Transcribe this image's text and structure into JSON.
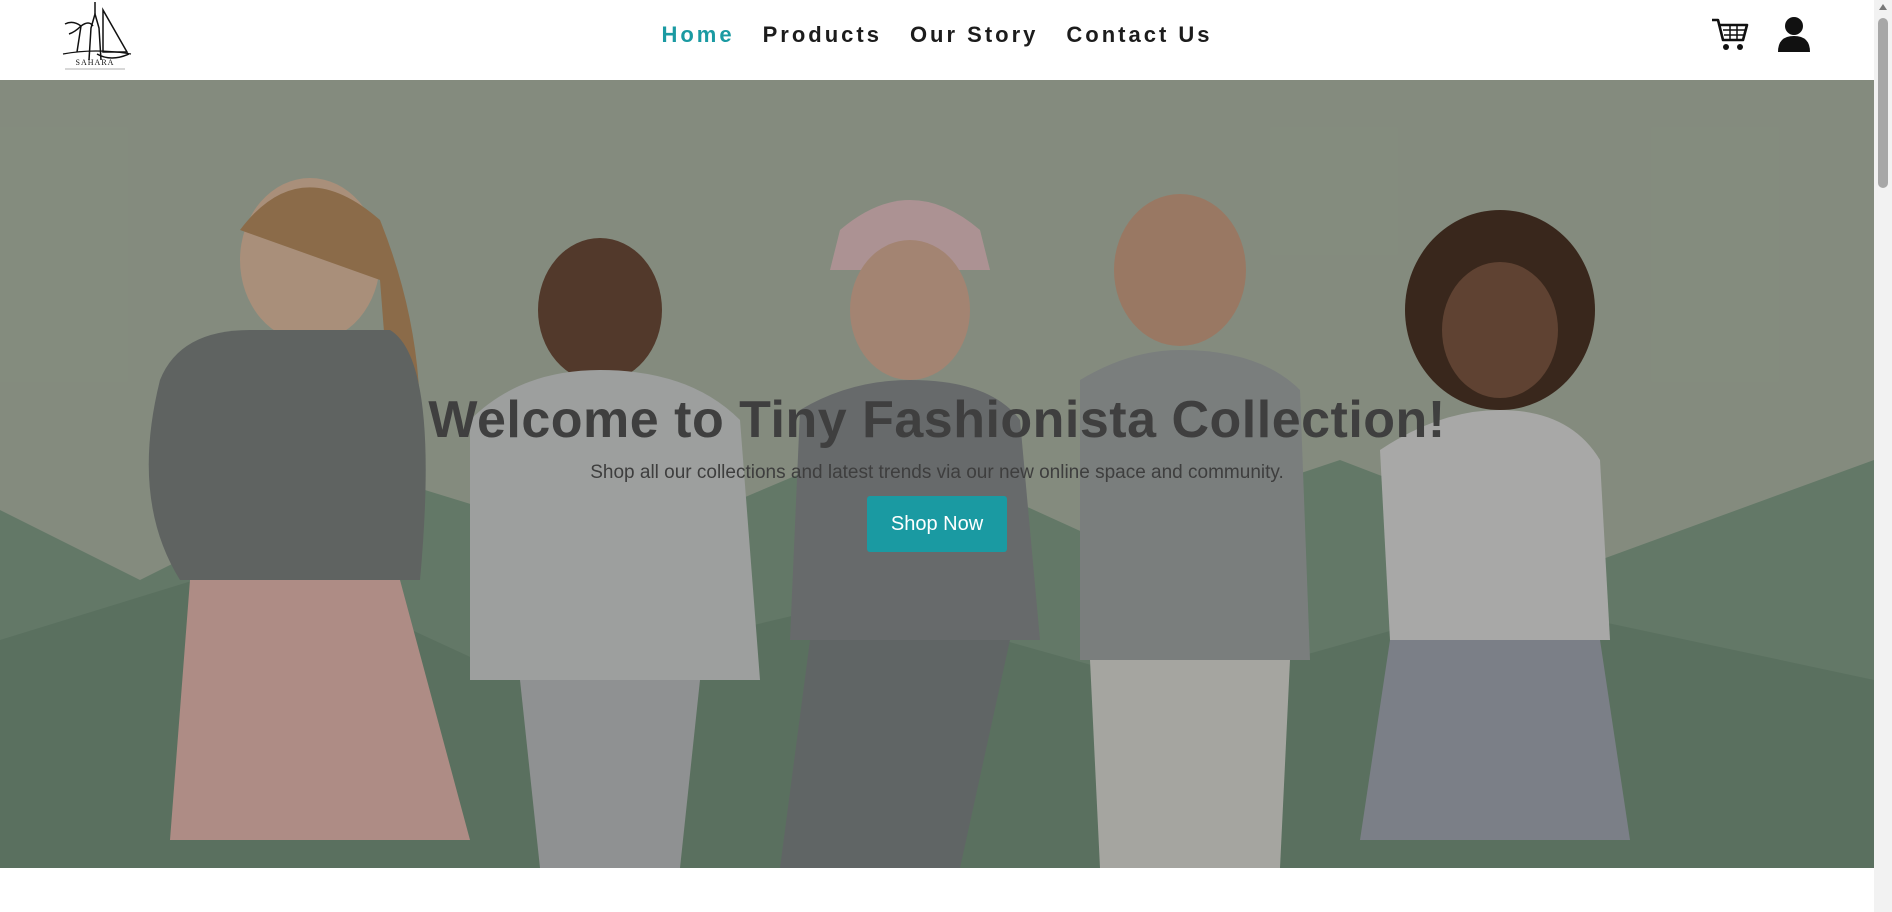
{
  "header": {
    "logo_text": "SAHARA",
    "nav": [
      {
        "label": "Home",
        "active": true
      },
      {
        "label": "Products",
        "active": false
      },
      {
        "label": "Our Story",
        "active": false
      },
      {
        "label": "Contact Us",
        "active": false
      }
    ],
    "icons": [
      "cart-icon",
      "user-icon"
    ]
  },
  "hero": {
    "title": "Welcome to Tiny Fashionista Collection!",
    "subtitle": "Shop all our collections and latest trends via our new online space and community.",
    "button_label": "Shop Now"
  },
  "colors": {
    "accent": "#1a9aa2",
    "nav_text": "#1c1c1c",
    "hero_text": "#3f3f3f"
  }
}
